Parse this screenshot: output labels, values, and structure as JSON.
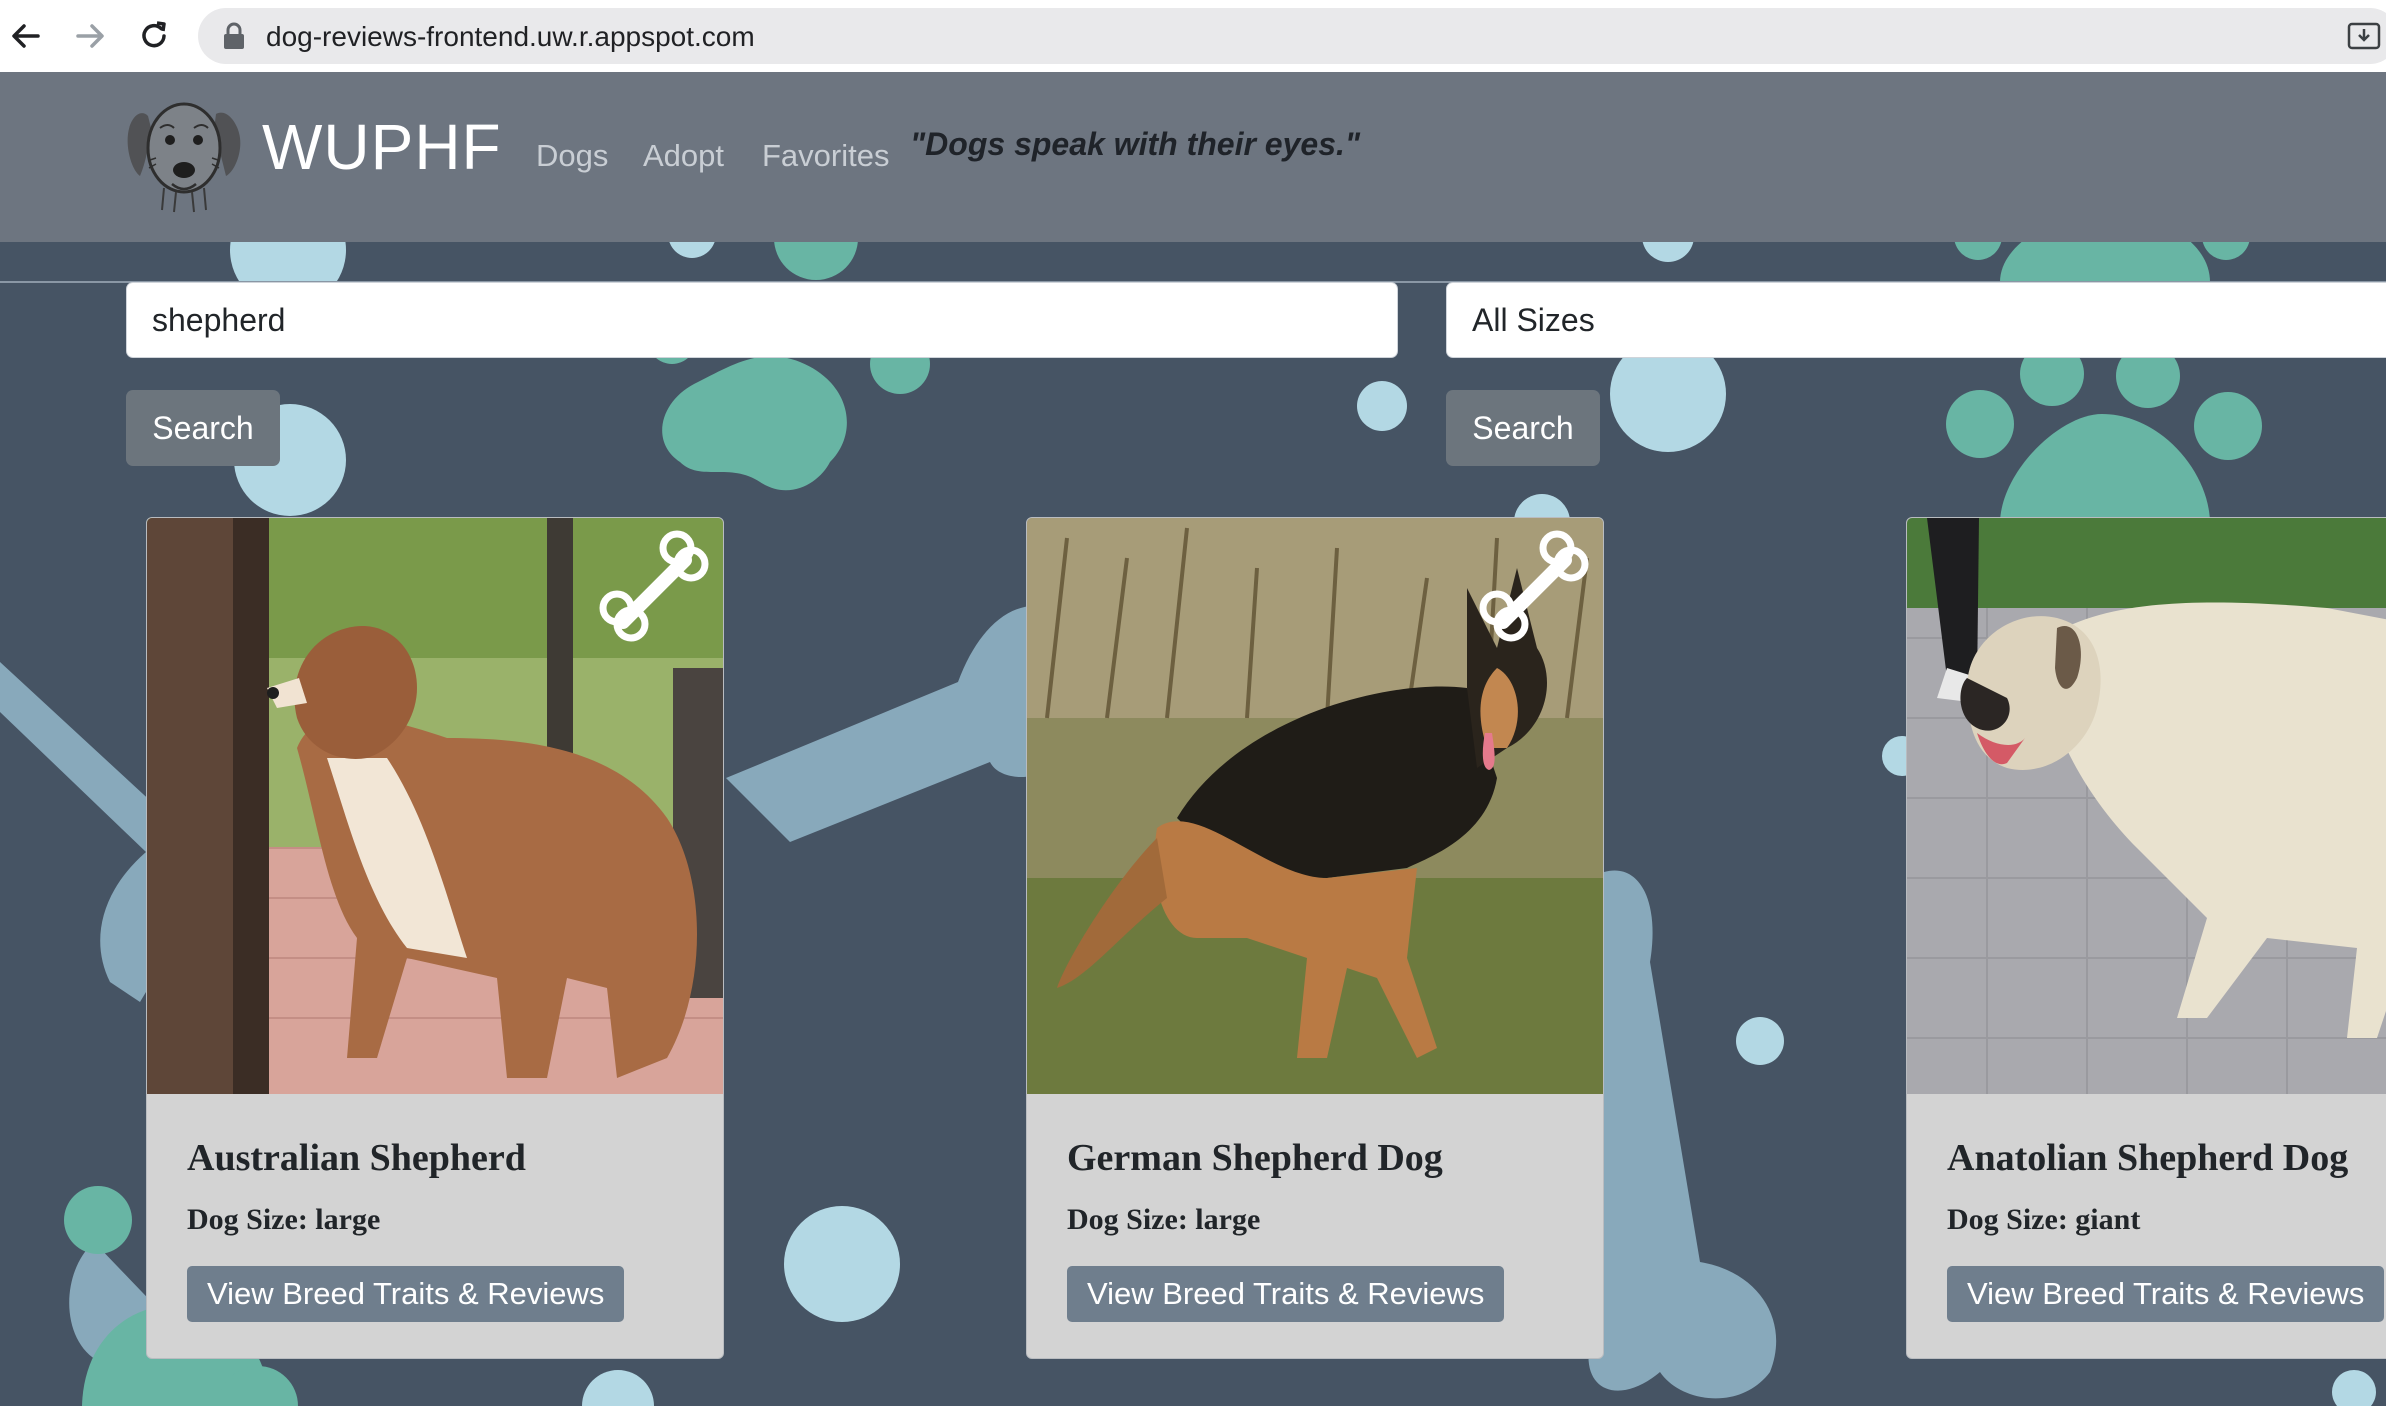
{
  "browser": {
    "url": "dog-reviews-frontend.uw.r.appspot.com"
  },
  "header": {
    "brand": "WUPHF",
    "nav": [
      "Dogs",
      "Adopt",
      "Favorites"
    ],
    "tagline": "\"Dogs speak with their eyes.\""
  },
  "search": {
    "query_value": "shepherd",
    "size_selected": "All Sizes",
    "search_button_label": "Search",
    "size_search_button_label": "Search"
  },
  "cards": [
    {
      "title": "Australian Shepherd",
      "size": "Dog Size: large",
      "button": "View Breed Traits & Reviews"
    },
    {
      "title": "German Shepherd Dog",
      "size": "Dog Size: large",
      "button": "View Breed Traits & Reviews"
    },
    {
      "title": "Anatolian Shepherd Dog",
      "size": "Dog Size: giant",
      "button": "View Breed Traits & Reviews"
    }
  ],
  "colors": {
    "page_background": "#465464",
    "header_background": "#6d7580",
    "accent_teal": "#68b5a4",
    "accent_light_blue": "#b3d8e4",
    "bone_blue": "#88a9bb",
    "button_gray": "#6c757d"
  }
}
